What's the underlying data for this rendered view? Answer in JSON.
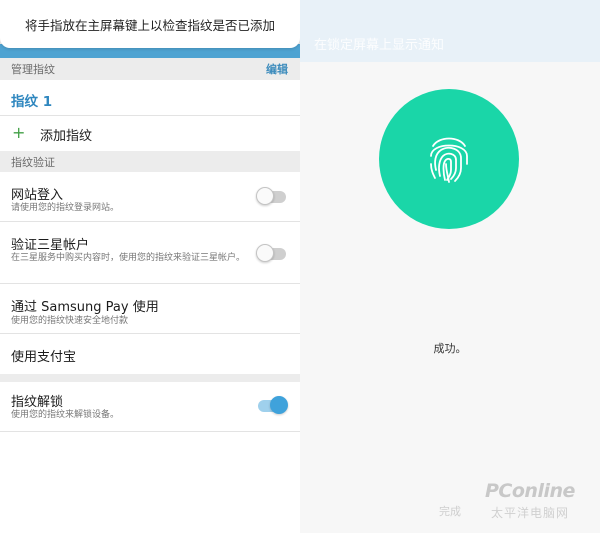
{
  "toast": {
    "text": "将手指放在主屏幕键上以检查指纹是否已添加"
  },
  "manage": {
    "header": "管理指纹",
    "edit": "编辑",
    "fingerprint_1": "指纹 1",
    "add_label": "添加指纹"
  },
  "verify": {
    "header": "指纹验证",
    "items": [
      {
        "title": "网站登入",
        "desc": "请使用您的指纹登录网站。",
        "toggle_on": false
      },
      {
        "title": "验证三星帐户",
        "desc": "在三星服务中购买内容时，使用您的指纹来验证三星帐户。",
        "toggle_on": false
      },
      {
        "title": "通过 Samsung Pay 使用",
        "desc": "使用您的指纹快速安全地付款"
      },
      {
        "title": "使用支付宝"
      }
    ]
  },
  "unlock": {
    "title": "指纹解锁",
    "desc": "使用您的指纹来解锁设备。",
    "toggle_on": true
  },
  "right": {
    "top_text": "在锁定屏幕上显示通知",
    "status": "成功。",
    "done": "完成",
    "circle_color": "#1ad6a8",
    "icon": "fingerprint-icon"
  },
  "watermark": {
    "logo": "PConline",
    "sub": "太平洋电脑网"
  },
  "colors": {
    "accent": "#3fa2db",
    "link": "#2f87bf",
    "add": "#43a047"
  }
}
